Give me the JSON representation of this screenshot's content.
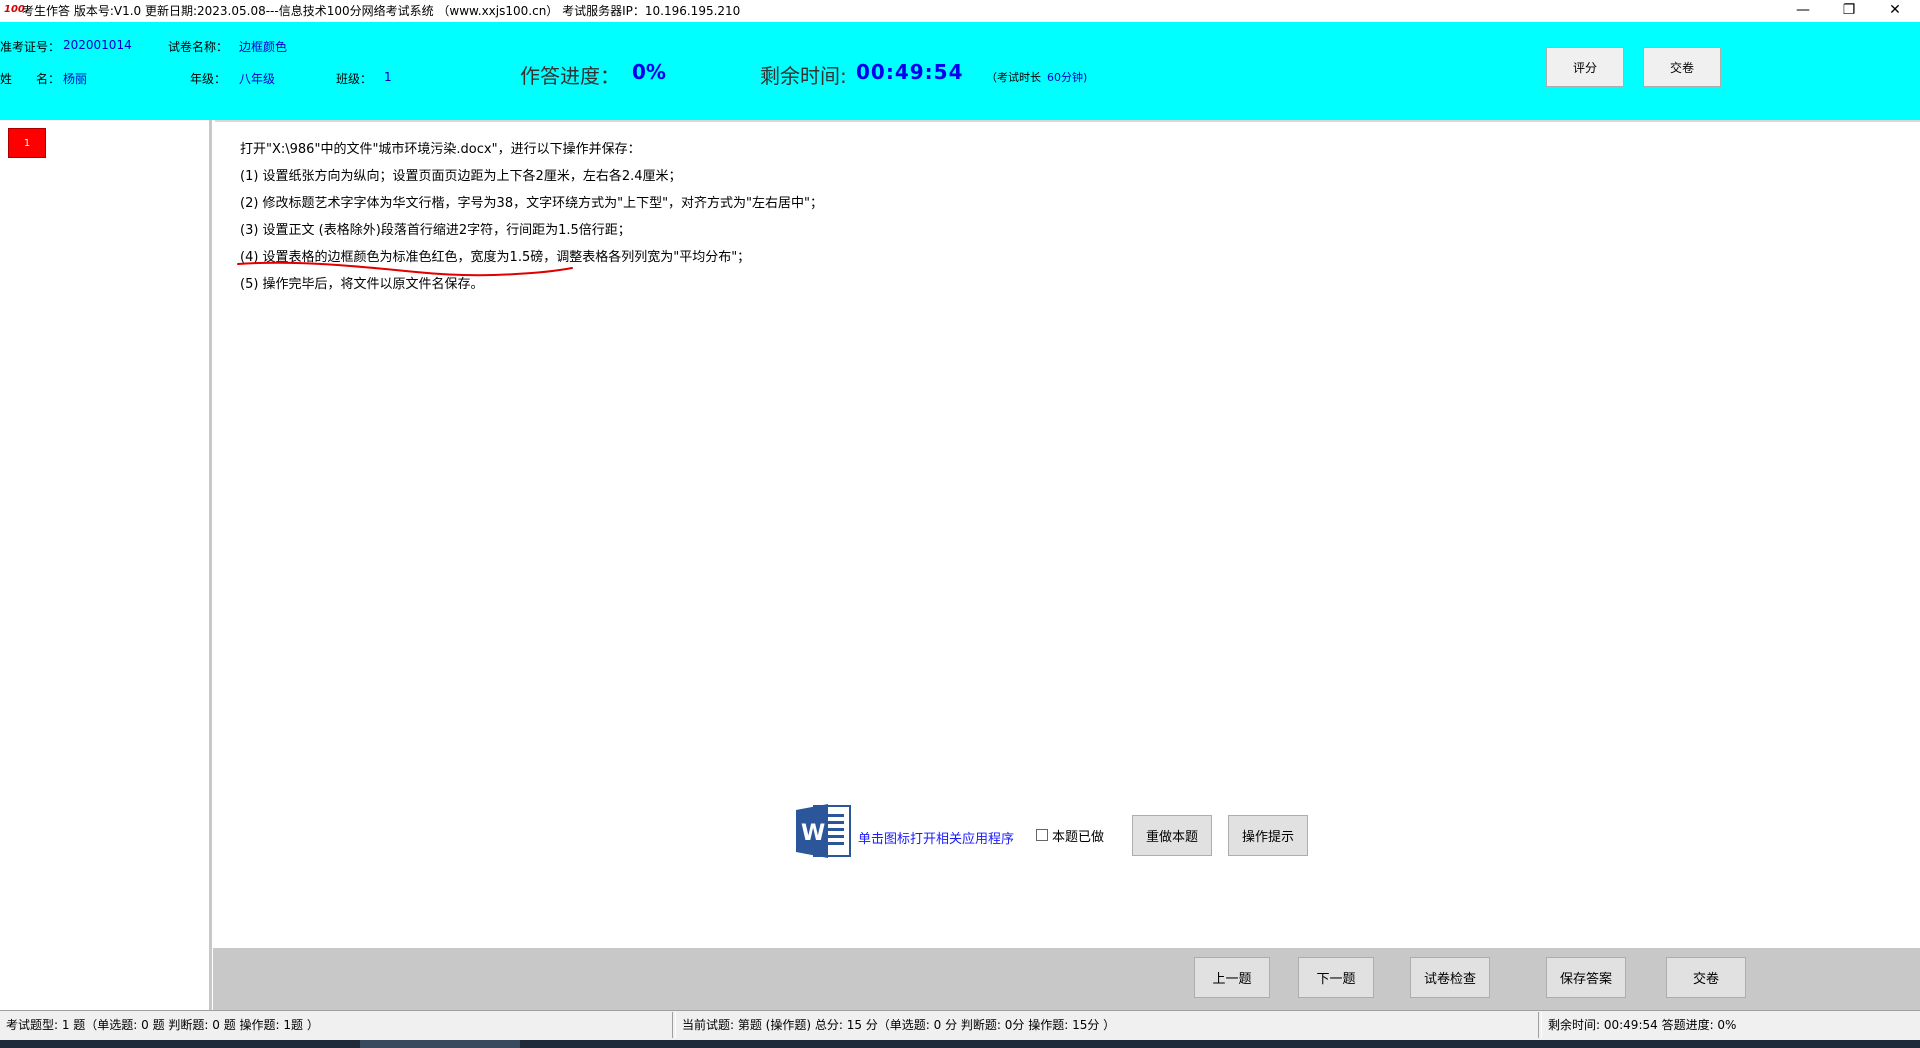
{
  "titlebar": {
    "logo": "100",
    "title": "考生作答 版本号:V1.0 更新日期:2023.05.08---信息技术100分网络考试系统 （www.xxjs100.cn）   考试服务器IP：10.196.195.210",
    "minimize": "—",
    "restore": "❐",
    "close": "✕"
  },
  "header": {
    "exam_id_label": "准考证号：",
    "exam_id_value": "202001014",
    "paper_label": "试卷名称：",
    "paper_value": "边框颜色",
    "name_label": "姓　　名：",
    "name_value": "杨丽",
    "grade_label": "年级：",
    "grade_value": "八年级",
    "class_label": "班级：",
    "class_value": "1",
    "progress_label": "作答进度：",
    "progress_value": "0%",
    "remaining_label": "剩余时间:",
    "remaining_value": "00:49:54",
    "duration_label": "（考试时长",
    "duration_value": "60分钟)",
    "score_button": "评分",
    "submit_button": "交卷"
  },
  "question_nav": {
    "items": [
      "1"
    ],
    "current_color": "#ff0000"
  },
  "question": {
    "intro": "打开\"X:\\986\"中的文件\"城市环境污染.docx\"，进行以下操作并保存：",
    "steps": [
      "(1)  设置纸张方向为纵向；设置页面页边距为上下各2厘米，左右各2.4厘米；",
      "(2) 修改标题艺术字字体为华文行楷，字号为38，文字环绕方式为\"上下型\"，对齐方式为\"左右居中\"；",
      "(3) 设置正文 (表格除外)段落首行缩进2字符，行间距为1.5倍行距；",
      "(4)  设置表格的边框颜色为标准色红色，宽度为1.5磅，调整表格各列列宽为\"平均分布\"；",
      "(5) 操作完毕后，将文件以原文件名保存。"
    ],
    "annotation_color": "#e00000"
  },
  "actions": {
    "word_icon": "word-icon",
    "open_app": "单击图标打开相关应用程序",
    "done_label": "本题已做",
    "done_checked": false,
    "redo_button": "重做本题",
    "hint_button": "操作提示"
  },
  "bottom_toolbar": {
    "prev": "上一题",
    "next": "下一题",
    "check": "试卷检查",
    "save": "保存答案",
    "submit": "交卷"
  },
  "status": {
    "types": "考试题型: 1 题（单选题: 0 题 判断题: 0 题 操作题: 1题 ）",
    "current": "当前试题: 第题 (操作题) 总分: 15 分（单选题: 0 分 判断题: 0分 操作题: 15分 ）",
    "remaining": "剩余时间: 00:49:54 答题进度: 0%"
  },
  "colors": {
    "header_bg": "#00ffff",
    "accent_text": "#0000ee",
    "toolbar_bg": "#c8c8c8"
  }
}
